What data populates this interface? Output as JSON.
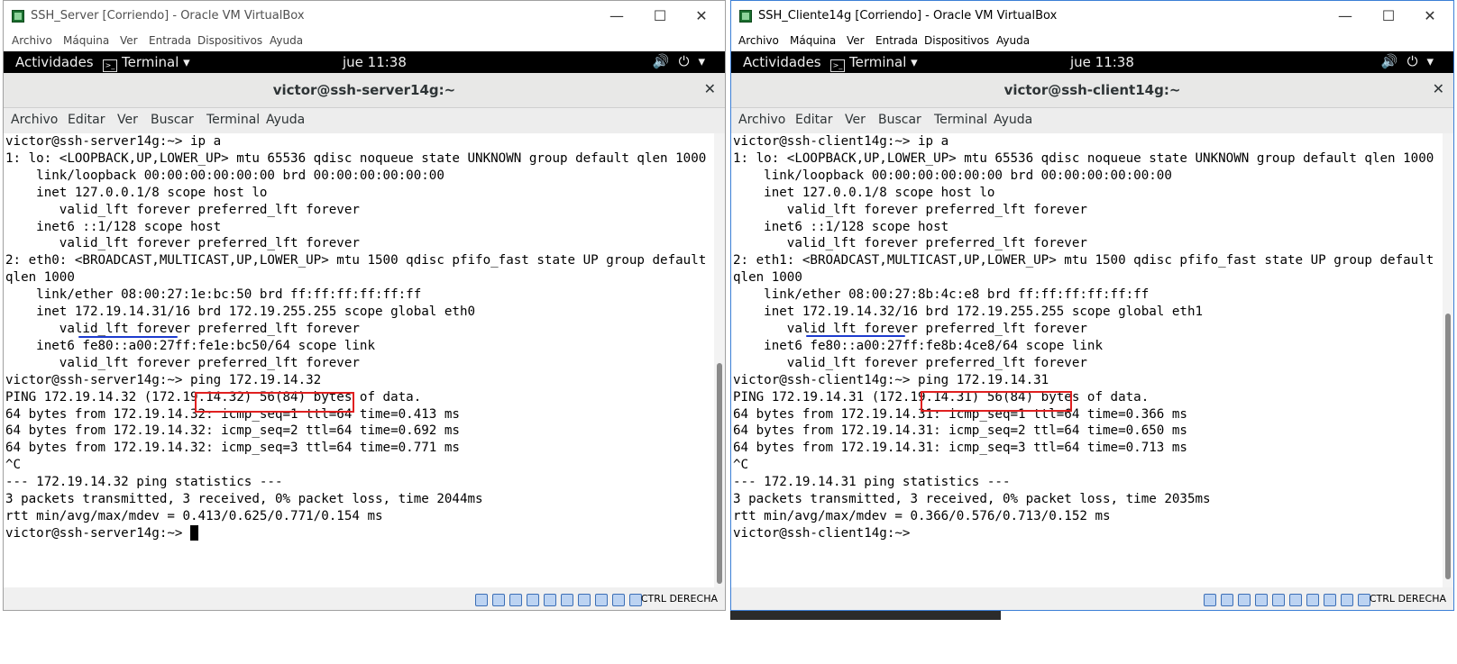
{
  "vm_menu": [
    "Archivo",
    "Máquina",
    "Ver",
    "Entrada",
    "Dispositivos",
    "Ayuda"
  ],
  "gnome": {
    "activities": "Actividades",
    "app": "Terminal",
    "clock": "jue 11:38"
  },
  "term_menu": [
    "Archivo",
    "Editar",
    "Ver",
    "Buscar",
    "Terminal",
    "Ayuda"
  ],
  "status_hotkey": "CTRL DERECHA",
  "left": {
    "window_title": "SSH_Server [Corriendo] - Oracle VM VirtualBox",
    "term_title": "victor@ssh-server14g:~",
    "output": "victor@ssh-server14g:~> ip a\n1: lo: <LOOPBACK,UP,LOWER_UP> mtu 65536 qdisc noqueue state UNKNOWN group default qlen 1000\n    link/loopback 00:00:00:00:00:00 brd 00:00:00:00:00:00\n    inet 127.0.0.1/8 scope host lo\n       valid_lft forever preferred_lft forever\n    inet6 ::1/128 scope host\n       valid_lft forever preferred_lft forever\n2: eth0: <BROADCAST,MULTICAST,UP,LOWER_UP> mtu 1500 qdisc pfifo_fast state UP group default qlen 1000\n    link/ether 08:00:27:1e:bc:50 brd ff:ff:ff:ff:ff:ff\n    inet 172.19.14.31/16 brd 172.19.255.255 scope global eth0\n       valid_lft forever preferred_lft forever\n    inet6 fe80::a00:27ff:fe1e:bc50/64 scope link\n       valid_lft forever preferred_lft forever\nvictor@ssh-server14g:~> ping 172.19.14.32\nPING 172.19.14.32 (172.19.14.32) 56(84) bytes of data.\n64 bytes from 172.19.14.32: icmp_seq=1 ttl=64 time=0.413 ms\n64 bytes from 172.19.14.32: icmp_seq=2 ttl=64 time=0.692 ms\n64 bytes from 172.19.14.32: icmp_seq=3 ttl=64 time=0.771 ms\n^C\n--- 172.19.14.32 ping statistics ---\n3 packets transmitted, 3 received, 0% packet loss, time 2044ms\nrtt min/avg/max/mdev = 0.413/0.625/0.771/0.154 ms\nvictor@ssh-server14g:~> "
  },
  "right": {
    "window_title": "SSH_Cliente14g [Corriendo] - Oracle VM VirtualBox",
    "term_title": "victor@ssh-client14g:~",
    "output": "victor@ssh-client14g:~> ip a\n1: lo: <LOOPBACK,UP,LOWER_UP> mtu 65536 qdisc noqueue state UNKNOWN group default qlen 1000\n    link/loopback 00:00:00:00:00:00 brd 00:00:00:00:00:00\n    inet 127.0.0.1/8 scope host lo\n       valid_lft forever preferred_lft forever\n    inet6 ::1/128 scope host\n       valid_lft forever preferred_lft forever\n2: eth1: <BROADCAST,MULTICAST,UP,LOWER_UP> mtu 1500 qdisc pfifo_fast state UP group default qlen 1000\n    link/ether 08:00:27:8b:4c:e8 brd ff:ff:ff:ff:ff:ff\n    inet 172.19.14.32/16 brd 172.19.255.255 scope global eth1\n       valid_lft forever preferred_lft forever\n    inet6 fe80::a00:27ff:fe8b:4ce8/64 scope link\n       valid_lft forever preferred_lft forever\nvictor@ssh-client14g:~> ping 172.19.14.31\nPING 172.19.14.31 (172.19.14.31) 56(84) bytes of data.\n64 bytes from 172.19.14.31: icmp_seq=1 ttl=64 time=0.366 ms\n64 bytes from 172.19.14.31: icmp_seq=2 ttl=64 time=0.650 ms\n64 bytes from 172.19.14.31: icmp_seq=3 ttl=64 time=0.713 ms\n^C\n--- 172.19.14.31 ping statistics ---\n3 packets transmitted, 3 received, 0% packet loss, time 2035ms\nrtt min/avg/max/mdev = 0.366/0.576/0.713/0.152 ms\nvictor@ssh-client14g:~>"
  }
}
